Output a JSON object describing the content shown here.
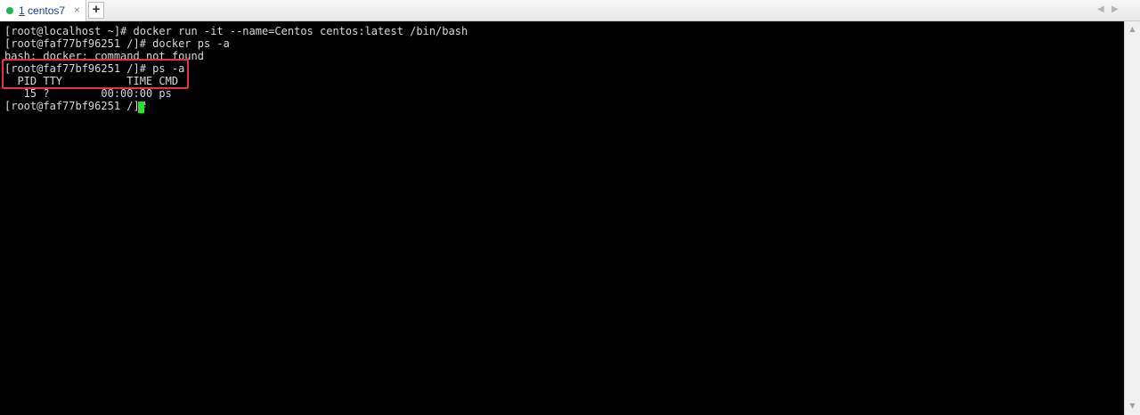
{
  "tabs": [
    {
      "number": "1",
      "name": "centos7",
      "status": "connected"
    }
  ],
  "tab_close_glyph": "×",
  "new_tab_glyph": "+",
  "nav": {
    "prev": "◀",
    "next": "▶"
  },
  "terminal": {
    "lines": [
      "[root@localhost ~]# docker run -it --name=Centos centos:latest /bin/bash",
      "[root@faf77bf96251 /]# docker ps -a",
      "bash: docker: command not found",
      "[root@faf77bf96251 /]# ps -a",
      "  PID TTY          TIME CMD",
      "   15 ?        00:00:00 ps",
      "[root@faf77bf96251 /]# "
    ],
    "colors": {
      "background": "#000000",
      "foreground": "#d8d8d8",
      "cursor": "#22e622",
      "highlight": "#e8333a"
    }
  },
  "scrollbar": {
    "up": "▲",
    "down": "▼"
  }
}
